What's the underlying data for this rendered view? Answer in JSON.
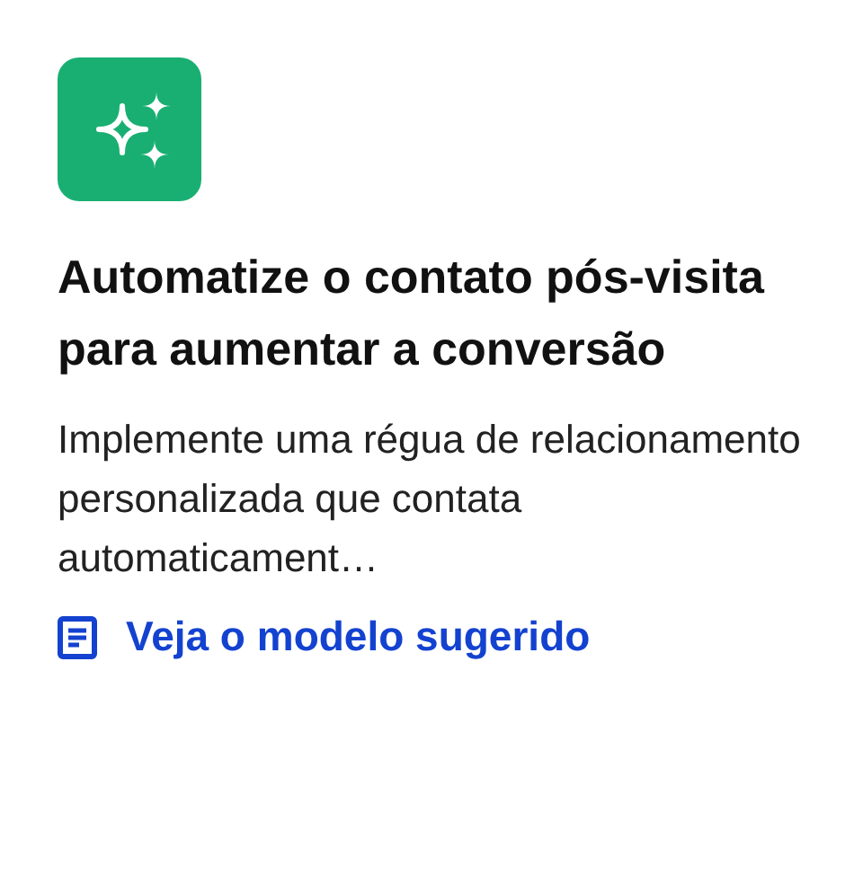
{
  "card": {
    "title": "Automatize o contato pós-visita para aumentar a conversão",
    "description": "Implemente uma régua de relacionamento personalizada que contata automaticament…",
    "link": "Veja o modelo sugerido"
  }
}
